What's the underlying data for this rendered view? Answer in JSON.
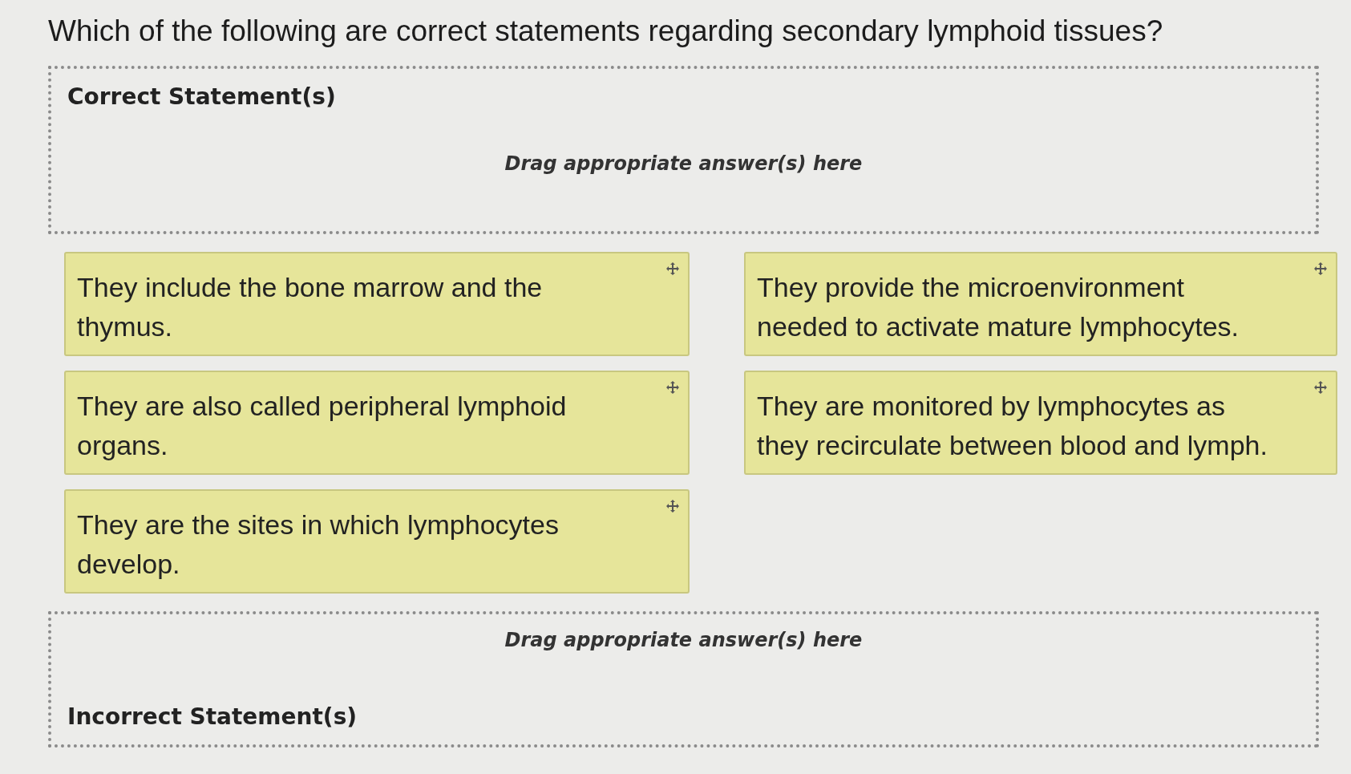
{
  "question": "Which of the following are correct statements regarding secondary lymphoid tissues?",
  "zones": [
    {
      "kind": "correct",
      "heading": "Correct Statement(s)",
      "hint": "Drag appropriate answer(s) here"
    },
    {
      "kind": "incorrect",
      "heading": "Incorrect Statement(s)",
      "hint": "Drag appropriate answer(s) here"
    }
  ],
  "answer_columns": [
    {
      "answers": [
        "They include the bone marrow and the thymus.",
        "They are also called peripheral lymphoid organs.",
        "They are the sites in which lymphocytes develop."
      ]
    },
    {
      "answers": [
        "They provide the microenvironment needed to activate mature lymphocytes.",
        "They are monitored by lymphocytes as they recirculate between blood and lymph."
      ]
    }
  ]
}
